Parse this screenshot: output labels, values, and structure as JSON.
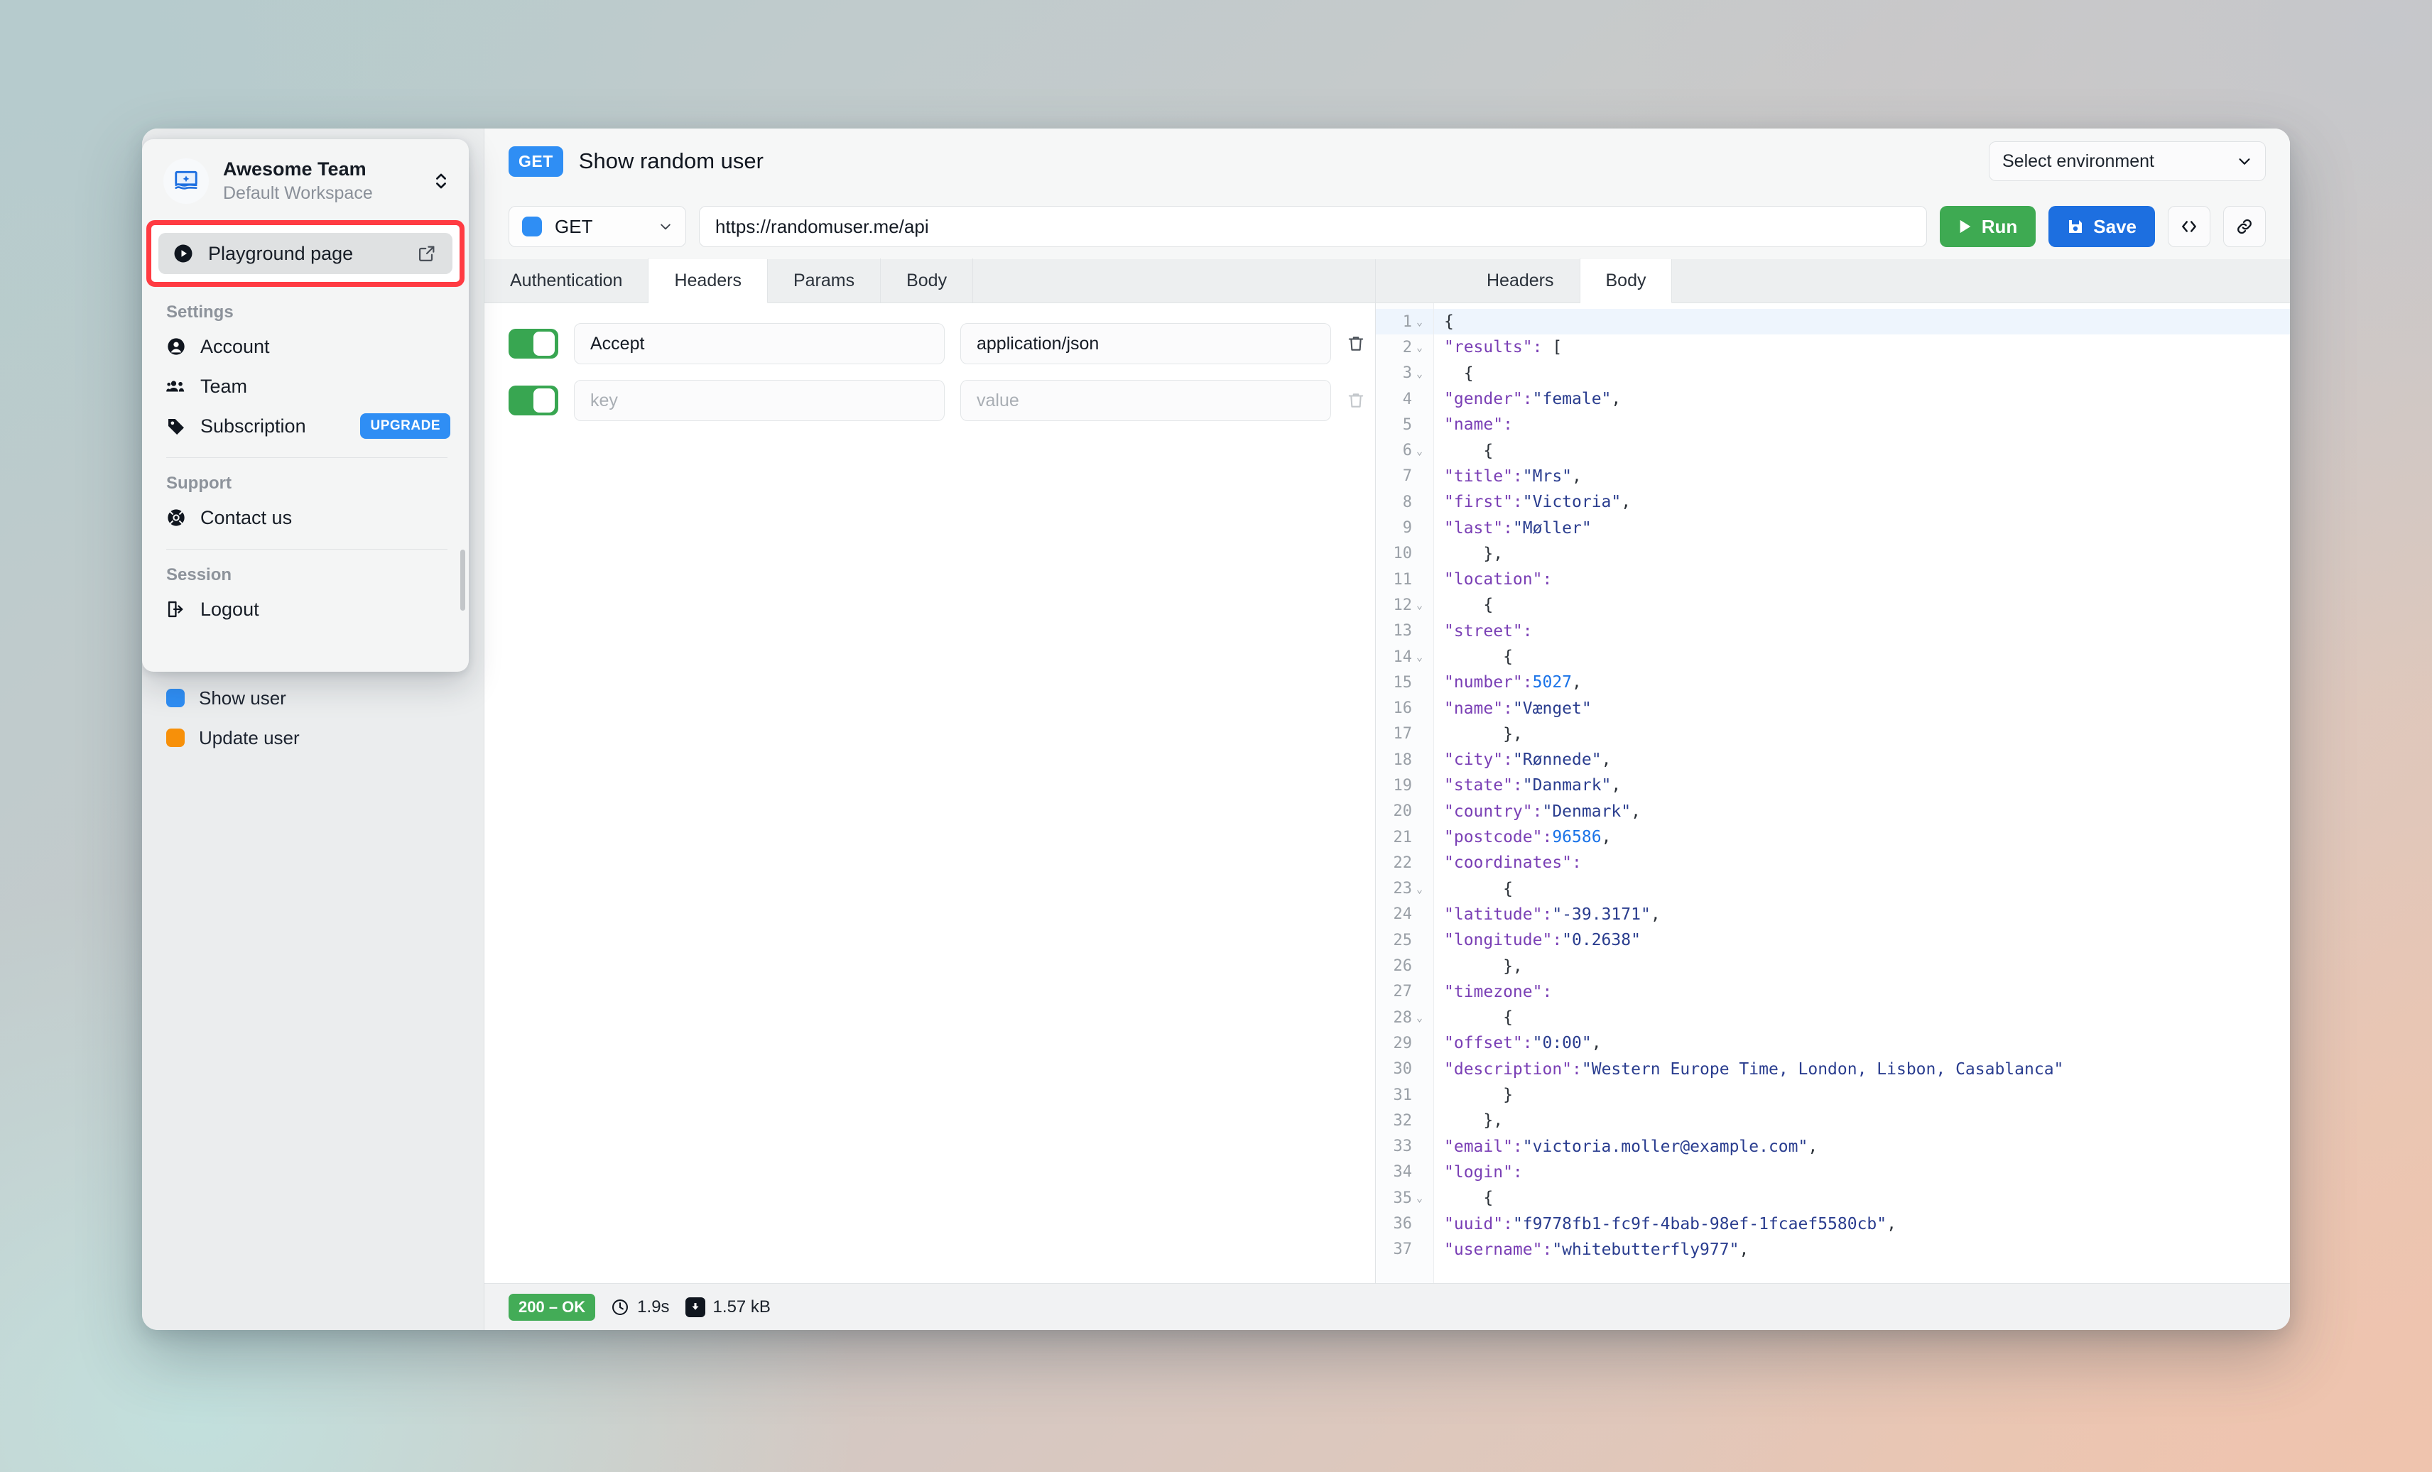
{
  "workspace": {
    "title": "Awesome Team",
    "subtitle": "Default Workspace",
    "logo_icon": "image-flag-icon",
    "switch_icon": "chevron-up-down-icon",
    "playground": {
      "label": "Playground page",
      "icon": "play-circle-icon",
      "external_icon": "external-link-icon"
    },
    "sections": [
      {
        "label": "Settings",
        "items": [
          {
            "label": "Account",
            "icon": "user-circle-icon",
            "badge": ""
          },
          {
            "label": "Team",
            "icon": "users-icon",
            "badge": ""
          },
          {
            "label": "Subscription",
            "icon": "tag-icon",
            "badge": "UPGRADE"
          }
        ]
      },
      {
        "label": "Support",
        "items": [
          {
            "label": "Contact us",
            "icon": "lifebuoy-icon",
            "badge": ""
          }
        ]
      },
      {
        "label": "Session",
        "items": [
          {
            "label": "Logout",
            "icon": "logout-icon",
            "badge": ""
          }
        ]
      }
    ]
  },
  "sidebar_requests": [
    {
      "label": "Show user",
      "color": "#2f8ef4"
    },
    {
      "label": "Update user",
      "color": "#f79009"
    }
  ],
  "topbar": {
    "method_chip": "GET",
    "request_name": "Show random user",
    "environment": {
      "label": "Select environment",
      "chevron_icon": "chevron-down-icon"
    }
  },
  "urlbar": {
    "method": "GET",
    "method_dot_color": "#2f8ef4",
    "url": "https://randomuser.me/api",
    "run_label": "Run",
    "run_icon": "play-icon",
    "save_label": "Save",
    "save_icon": "floppy-disk-icon",
    "code_icon": "code-brackets-icon",
    "link_icon": "link-icon"
  },
  "request_tabs": [
    {
      "label": "Authentication",
      "active": false
    },
    {
      "label": "Headers",
      "active": true
    },
    {
      "label": "Params",
      "active": false
    },
    {
      "label": "Body",
      "active": false
    }
  ],
  "response_tabs": [
    {
      "label": "Headers",
      "active": false
    },
    {
      "label": "Body",
      "active": true
    }
  ],
  "headers_rows": [
    {
      "enabled": true,
      "key": "Accept",
      "value": "application/json",
      "key_placeholder": "key",
      "value_placeholder": "value",
      "is_placeholder": false,
      "delete_icon": "trash-icon"
    },
    {
      "enabled": true,
      "key": "",
      "value": "",
      "key_placeholder": "key",
      "value_placeholder": "value",
      "is_placeholder": true,
      "delete_icon": "trash-icon"
    }
  ],
  "response_code": {
    "language": "json",
    "lines": [
      {
        "n": 1,
        "fold": true,
        "text": "{"
      },
      {
        "n": 2,
        "fold": true,
        "text": "  \"results\": ["
      },
      {
        "n": 3,
        "fold": true,
        "text": "  {"
      },
      {
        "n": 4,
        "fold": false,
        "text": "    \"gender\": \"female\","
      },
      {
        "n": 5,
        "fold": false,
        "text": "    \"name\":"
      },
      {
        "n": 6,
        "fold": true,
        "text": "    {"
      },
      {
        "n": 7,
        "fold": false,
        "text": "      \"title\": \"Mrs\","
      },
      {
        "n": 8,
        "fold": false,
        "text": "      \"first\": \"Victoria\","
      },
      {
        "n": 9,
        "fold": false,
        "text": "      \"last\": \"Møller\""
      },
      {
        "n": 10,
        "fold": false,
        "text": "    },"
      },
      {
        "n": 11,
        "fold": false,
        "text": "    \"location\":"
      },
      {
        "n": 12,
        "fold": true,
        "text": "    {"
      },
      {
        "n": 13,
        "fold": false,
        "text": "      \"street\":"
      },
      {
        "n": 14,
        "fold": true,
        "text": "      {"
      },
      {
        "n": 15,
        "fold": false,
        "text": "        \"number\": 5027,"
      },
      {
        "n": 16,
        "fold": false,
        "text": "        \"name\": \"Vænget\""
      },
      {
        "n": 17,
        "fold": false,
        "text": "      },"
      },
      {
        "n": 18,
        "fold": false,
        "text": "      \"city\": \"Rønnede\","
      },
      {
        "n": 19,
        "fold": false,
        "text": "      \"state\": \"Danmark\","
      },
      {
        "n": 20,
        "fold": false,
        "text": "      \"country\": \"Denmark\","
      },
      {
        "n": 21,
        "fold": false,
        "text": "      \"postcode\": 96586,"
      },
      {
        "n": 22,
        "fold": false,
        "text": "      \"coordinates\":"
      },
      {
        "n": 23,
        "fold": true,
        "text": "      {"
      },
      {
        "n": 24,
        "fold": false,
        "text": "        \"latitude\": \"-39.3171\","
      },
      {
        "n": 25,
        "fold": false,
        "text": "        \"longitude\": \"0.2638\""
      },
      {
        "n": 26,
        "fold": false,
        "text": "      },"
      },
      {
        "n": 27,
        "fold": false,
        "text": "      \"timezone\":"
      },
      {
        "n": 28,
        "fold": true,
        "text": "      {"
      },
      {
        "n": 29,
        "fold": false,
        "text": "        \"offset\": \"0:00\","
      },
      {
        "n": 30,
        "fold": false,
        "text": "        \"description\": \"Western Europe Time, London, Lisbon, Casablanca\""
      },
      {
        "n": 31,
        "fold": false,
        "text": "      }"
      },
      {
        "n": 32,
        "fold": false,
        "text": "    },"
      },
      {
        "n": 33,
        "fold": false,
        "text": "    \"email\": \"victoria.moller@example.com\","
      },
      {
        "n": 34,
        "fold": false,
        "text": "    \"login\":"
      },
      {
        "n": 35,
        "fold": true,
        "text": "    {"
      },
      {
        "n": 36,
        "fold": false,
        "text": "      \"uuid\": \"f9778fb1-fc9f-4bab-98ef-1fcaef5580cb\","
      },
      {
        "n": 37,
        "fold": false,
        "text": "      \"username\": \"whitebutterfly977\","
      }
    ]
  },
  "statusbar": {
    "status": "200 – OK",
    "time": "1.9s",
    "size": "1.57 kB",
    "clock_icon": "clock-icon",
    "size_icon": "download-box-icon"
  },
  "colors": {
    "accent_blue": "#2f8ef4",
    "save_blue": "#1d6fe0",
    "run_green": "#3eaa52",
    "status_green": "#43ac57",
    "toggle_green": "#38a651",
    "highlight_red": "#ff3b42",
    "upgrade_blue": "#2f8ef4",
    "orange": "#f79009"
  }
}
